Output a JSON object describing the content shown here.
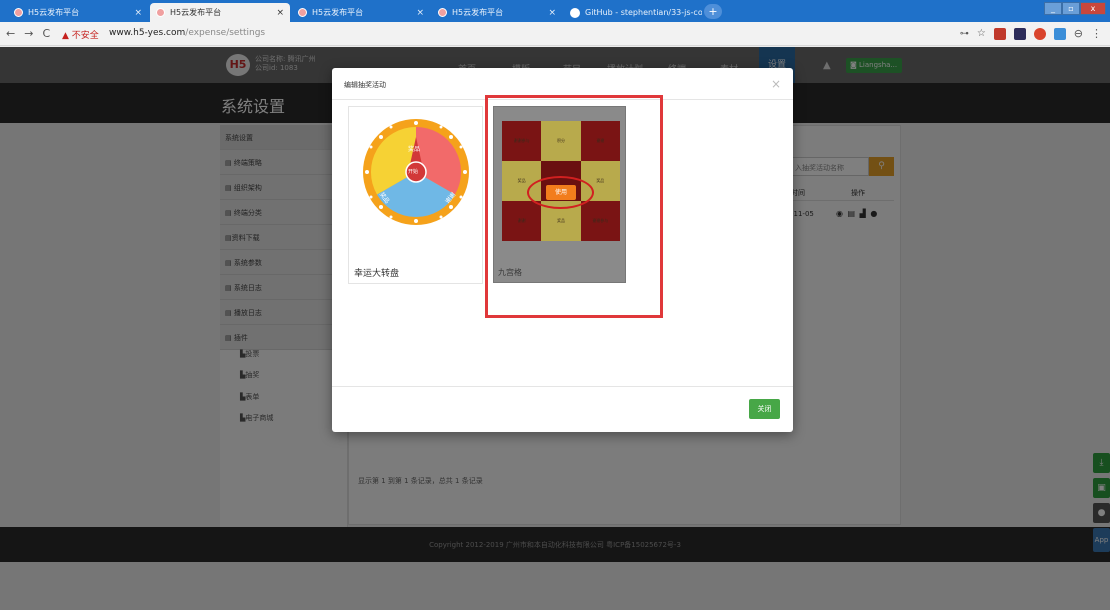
{
  "browser": {
    "tabs": [
      {
        "title": "H5云发布平台",
        "close": "×"
      },
      {
        "title": "H5云发布平台",
        "close": "×"
      },
      {
        "title": "H5云发布平台",
        "close": "×"
      },
      {
        "title": "H5云发布平台",
        "close": "×"
      },
      {
        "title": "GitHub - stephentian/33-js-co:",
        "close": "×"
      }
    ],
    "new_tab": "+",
    "security_label": "▲ 不安全",
    "url_host": "www.h5-yes.com",
    "url_path": "/expense/settings",
    "nav": {
      "back": "←",
      "forward": "→",
      "reload": "C"
    }
  },
  "site": {
    "logo_text": "H5",
    "company_line1": "公司名称: 腾讯广州",
    "company_line2": "公司id: 1083",
    "nav_items": [
      "首页",
      "模版",
      "节目",
      "播放计划",
      "终端",
      "素材"
    ],
    "nav_active": "设置",
    "user_label": "Liangsha...",
    "page_title": "系统设置"
  },
  "sidebar": {
    "header": "系统设置",
    "items": [
      "终端策略",
      "组织架构",
      "终端分类",
      "资料下载",
      "系统参数",
      "系统日志",
      "播放日志",
      "插件"
    ],
    "plugins": [
      "投票",
      "抽奖",
      "表单",
      "电子商城"
    ]
  },
  "content": {
    "search_placeholder": "入抽奖活动名称",
    "col_time": "时间",
    "col_ops": "操作",
    "row_date": "-11-05",
    "row_ops": "◉ ▤ ▟ ●",
    "pager": "显示第 1 到第 1 条记录，总共 1 条记录"
  },
  "modal": {
    "title": "编辑抽奖活动",
    "close": "×",
    "template1_name": "幸运大转盘",
    "template1_start": "开始",
    "wheel_segments": [
      "奖品",
      "谢谢",
      "奖品"
    ],
    "template2_name": "九宫格",
    "use_button": "使用",
    "grid_cells": [
      "谢谢参与",
      "积分",
      "谢谢",
      "奖品",
      "",
      "奖品",
      "谢谢",
      "奖品",
      "谢谢参与"
    ],
    "close_button": "关闭"
  },
  "footer": {
    "copyright": "Copyright 2012-2019 广州市和本自动化科技有限公司 粤ICP备15025672号-3"
  },
  "floaters": {
    "app": "App"
  },
  "colors": {
    "tab_bar": "#1f71c9",
    "nav_active": "#2b6aa3",
    "close_button": "#47a747",
    "use_button": "#f27d1c",
    "highlight": "#e0383a"
  }
}
